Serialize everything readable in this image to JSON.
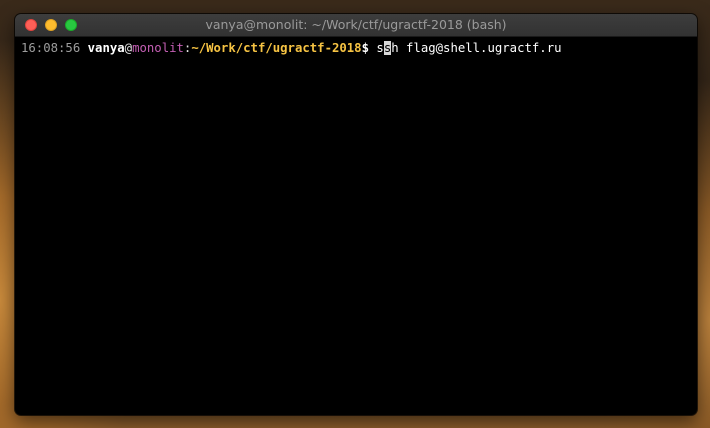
{
  "window": {
    "title": "vanya@monolit: ~/Work/ctf/ugractf-2018 (bash)"
  },
  "prompt": {
    "time": "16:08:56",
    "user": "vanya",
    "at": "@",
    "host": "monolit",
    "colon": ":",
    "path": "~/Work/ctf/ugractf-2018",
    "dollar": "$"
  },
  "command": {
    "before_cursor": "s",
    "cursor_char": "s",
    "after_cursor": "h flag@shell.ugractf.ru"
  },
  "icons": {
    "close": "close-traffic-light-icon",
    "minimize": "minimize-traffic-light-icon",
    "zoom": "zoom-traffic-light-icon"
  },
  "colors": {
    "close": "#fe5f57",
    "minimize": "#febc2e",
    "zoom": "#28c840",
    "host": "#c45fb4",
    "path": "#f6c343",
    "terminal_bg": "#000000"
  }
}
